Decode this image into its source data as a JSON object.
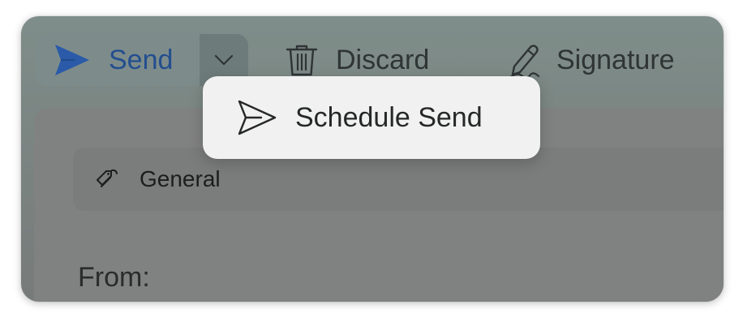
{
  "toolbar": {
    "send_label": "Send",
    "discard_label": "Discard",
    "signature_label": "Signature"
  },
  "popup": {
    "schedule_send_label": "Schedule Send"
  },
  "compose": {
    "sensitivity_label": "General",
    "from_label": "From:"
  },
  "colors": {
    "send_accent": "#234e8e",
    "popup_bg": "#f1f1f1"
  },
  "icons": {
    "send": "send-arrow-icon",
    "dropdown": "chevron-down-icon",
    "discard": "trash-icon",
    "signature": "pen-signature-icon",
    "schedule": "send-outline-icon",
    "label": "tag-icon"
  }
}
